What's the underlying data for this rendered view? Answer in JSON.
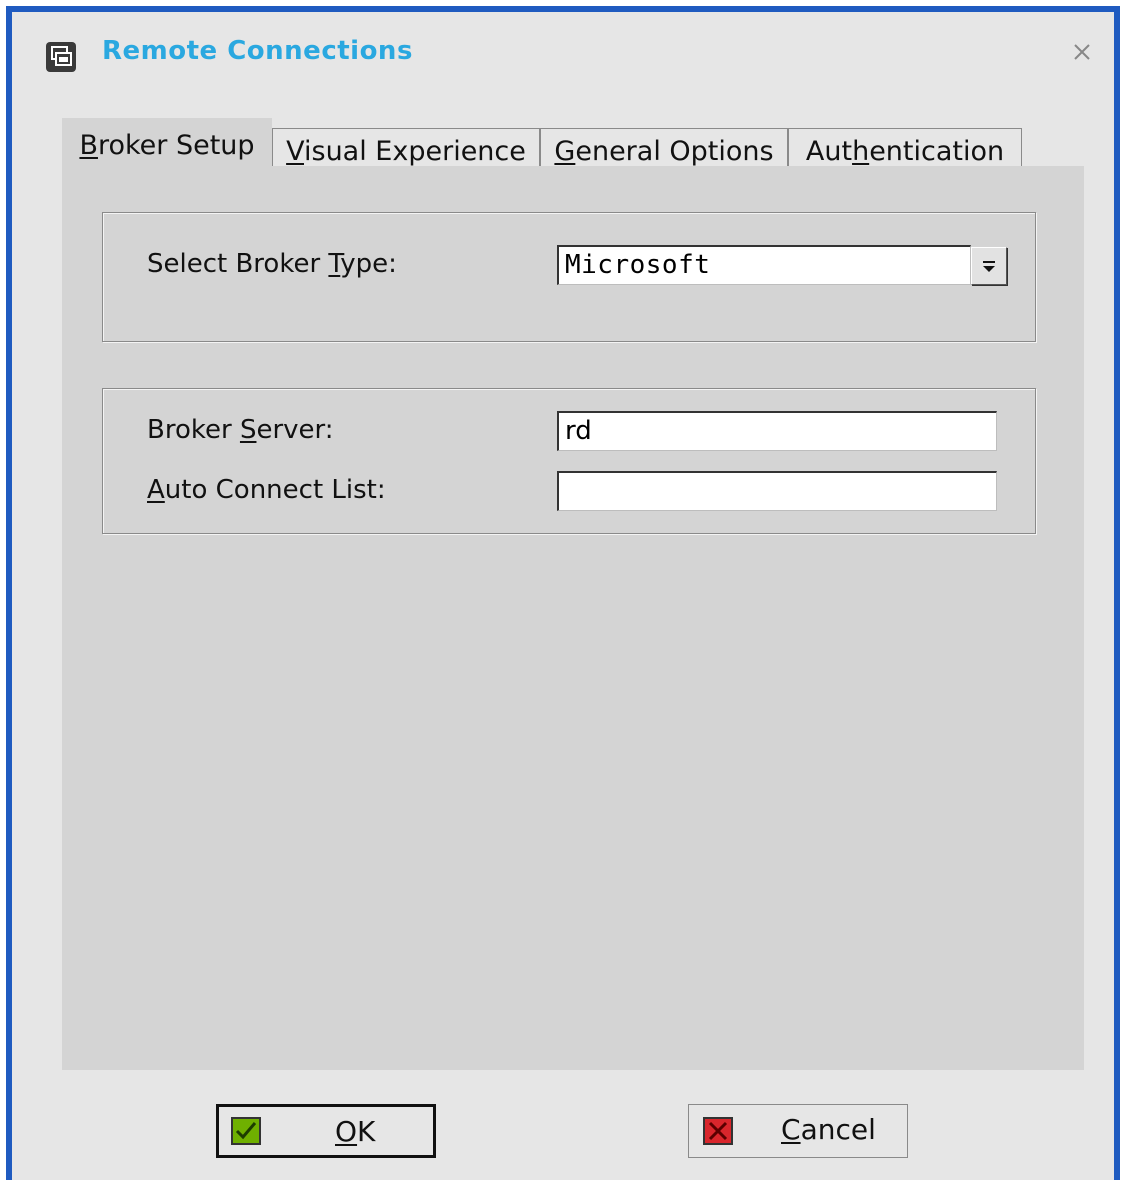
{
  "window": {
    "title": "Remote Connections",
    "icon": "remote-connections-icon",
    "close_icon": "close-icon"
  },
  "tabs": [
    {
      "label_first": "B",
      "label_rest": "roker Setup",
      "active": true
    },
    {
      "label_first": "V",
      "label_rest": "isual Experience",
      "active": false
    },
    {
      "label_first": "G",
      "label_rest": "eneral Options",
      "active": false
    },
    {
      "label_pre": "Aut",
      "label_u": "h",
      "label_post": "entication",
      "active": false
    }
  ],
  "broker_type": {
    "label_pre": "Select Broker ",
    "label_u": "T",
    "label_post": "ype:",
    "selected_value": "Microsoft"
  },
  "broker_server": {
    "label_pre": "Broker ",
    "label_u": "S",
    "label_post": "erver:",
    "value": "rd"
  },
  "auto_connect": {
    "label_u": "A",
    "label_post": "uto Connect List:",
    "value": ""
  },
  "buttons": {
    "ok_label": "OK",
    "ok_u": "O",
    "ok_rest": "K",
    "cancel_u": "C",
    "cancel_rest": "ancel"
  },
  "colors": {
    "title": "#2aa8e0",
    "window_border": "#1f5bc0",
    "ok_check": "#6fb000",
    "cancel_x": "#d9262c"
  }
}
